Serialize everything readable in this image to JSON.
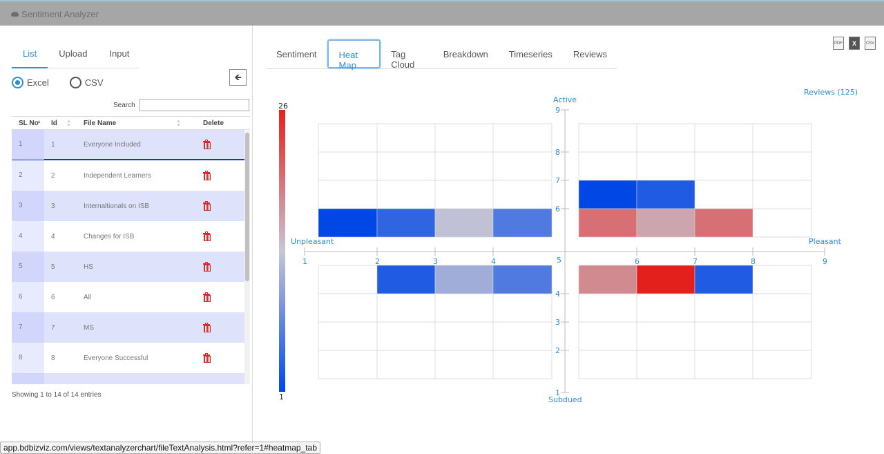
{
  "app": {
    "title": "Sentiment Analyzer",
    "logo_icon": "cloud-icon"
  },
  "left_panel": {
    "tabs": [
      {
        "label": "List",
        "active": true
      },
      {
        "label": "Upload",
        "active": false
      },
      {
        "label": "Input",
        "active": false
      }
    ],
    "file_type": {
      "options": [
        {
          "label": "Excel",
          "selected": true
        },
        {
          "label": "CSV",
          "selected": false
        }
      ]
    },
    "collapse_icon": "arrow-left-icon",
    "search": {
      "label": "Search",
      "value": "",
      "placeholder": ""
    },
    "table": {
      "columns": [
        "SL No",
        "Id",
        "File Name",
        "Delete"
      ],
      "sort": {
        "column": "SL No",
        "direction": "asc"
      },
      "rows": [
        {
          "sl": "1",
          "id": "1",
          "name": "Everyone Included",
          "selected": true
        },
        {
          "sl": "2",
          "id": "2",
          "name": "Independent Learners"
        },
        {
          "sl": "3",
          "id": "3",
          "name": "Internaltionals on ISB"
        },
        {
          "sl": "4",
          "id": "4",
          "name": "Changes for ISB"
        },
        {
          "sl": "5",
          "id": "5",
          "name": "HS"
        },
        {
          "sl": "6",
          "id": "6",
          "name": "All"
        },
        {
          "sl": "7",
          "id": "7",
          "name": "MS"
        },
        {
          "sl": "8",
          "id": "8",
          "name": "Everyone Successful"
        }
      ],
      "info": "Showing 1 to 14 of 14 entries"
    }
  },
  "right_panel": {
    "tabs": [
      {
        "label": "Sentiment",
        "active": false
      },
      {
        "label": "Heat Map",
        "active": true
      },
      {
        "label": "Tag Cloud",
        "active": false
      },
      {
        "label": "Breakdown",
        "active": false
      },
      {
        "label": "Timeseries",
        "active": false
      },
      {
        "label": "Reviews",
        "active": false
      }
    ],
    "export_icons": [
      {
        "name": "pdf-export-icon",
        "label": "PDF"
      },
      {
        "name": "excel-export-icon",
        "label": "X"
      },
      {
        "name": "csv-export-icon",
        "label": "CSV"
      }
    ],
    "reviews_link": "Reviews (125)"
  },
  "chart_data": {
    "type": "heatmap",
    "title": "",
    "xlabel_left": "Unpleasant",
    "xlabel_right": "Pleasant",
    "ylabel_top": "Active",
    "ylabel_bottom": "Subdued",
    "xlim": [
      1,
      9
    ],
    "ylim": [
      1,
      9
    ],
    "x_ticks": [
      1,
      2,
      3,
      4,
      5,
      6,
      7,
      8,
      9
    ],
    "y_ticks": [
      1,
      2,
      3,
      4,
      5,
      6,
      7,
      8,
      9
    ],
    "colorscale": {
      "min": 1,
      "max": 26,
      "colors": [
        "#0047e6",
        "#c8c6d4",
        "#e3201b"
      ]
    },
    "colorbar_labels": {
      "max": "26",
      "min": "1"
    },
    "grid": true,
    "cells": [
      {
        "x0": 1,
        "x1": 2,
        "y0": 5,
        "y1": 6,
        "value": 1
      },
      {
        "x0": 2,
        "x1": 3,
        "y0": 5,
        "y1": 6,
        "value": 4
      },
      {
        "x0": 3,
        "x1": 4,
        "y0": 5,
        "y1": 6,
        "value": 13
      },
      {
        "x0": 4,
        "x1": 5,
        "y0": 5,
        "y1": 6,
        "value": 6
      },
      {
        "x0": 5,
        "x1": 6,
        "y0": 6,
        "y1": 7,
        "value": 1
      },
      {
        "x0": 6,
        "x1": 7,
        "y0": 6,
        "y1": 7,
        "value": 3
      },
      {
        "x0": 5,
        "x1": 6,
        "y0": 5,
        "y1": 6,
        "value": 20
      },
      {
        "x0": 6,
        "x1": 7,
        "y0": 5,
        "y1": 6,
        "value": 16
      },
      {
        "x0": 7,
        "x1": 8,
        "y0": 5,
        "y1": 6,
        "value": 20
      },
      {
        "x0": 2,
        "x1": 3,
        "y0": 4,
        "y1": 5,
        "value": 3
      },
      {
        "x0": 3,
        "x1": 4,
        "y0": 4,
        "y1": 5,
        "value": 11
      },
      {
        "x0": 4,
        "x1": 5,
        "y0": 4,
        "y1": 5,
        "value": 6
      },
      {
        "x0": 5,
        "x1": 6,
        "y0": 4,
        "y1": 5,
        "value": 18
      },
      {
        "x0": 6,
        "x1": 7,
        "y0": 4,
        "y1": 5,
        "value": 26
      },
      {
        "x0": 7,
        "x1": 8,
        "y0": 4,
        "y1": 5,
        "value": 3
      }
    ]
  },
  "status_bar": {
    "url": "app.bdbizviz.com/views/textanalyzerchart/fileTextAnalysis.html?refer=1#heatmap_tab"
  }
}
